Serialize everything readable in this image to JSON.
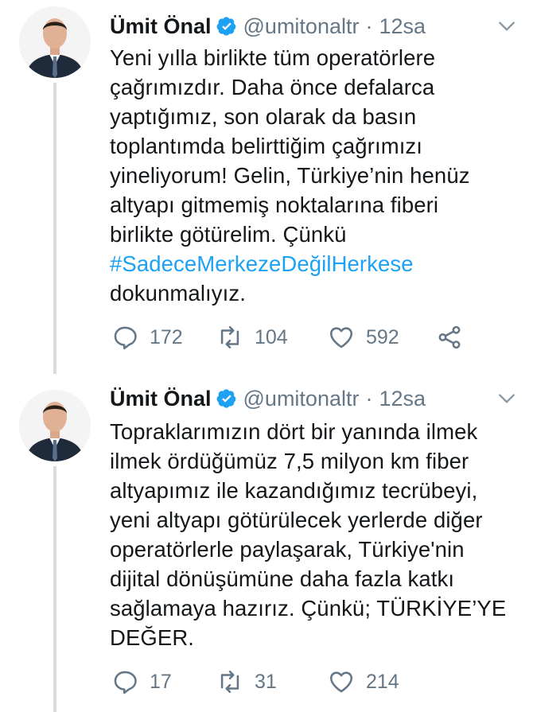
{
  "tweets": [
    {
      "name": "Ümit Önal",
      "handle": "@umitonaltr",
      "separator": "·",
      "time": "12sa",
      "text_before": "Yeni yılla birlikte tüm operatörlere\nçağrımızdır. Daha önce defalarca\nyaptığımız, son olarak da basın\ntoplantımda belirttiğim çağrımızı\nyineliyorum! Gelin, Türkiye’nin henüz\naltyapı gitmemiş noktalarına fiberi\nbirlikte götürelim. Çünkü\n",
      "hashtag": "#SadeceMerkezeDeğilHerkese",
      "text_after": "\ndokunmalıyız.",
      "replies": "172",
      "retweets": "104",
      "likes": "592"
    },
    {
      "name": "Ümit Önal",
      "handle": "@umitonaltr",
      "separator": "·",
      "time": "12sa",
      "text_before": "Topraklarımızın dört bir yanında ilmek\nilmek ördüğümüz 7,5 milyon km fiber\naltyapımız ile kazandığımız tecrübeyi,\nyeni altyapı götürülecek yerlerde diğer\noperatörlerle paylaşarak, Türkiye'nin\ndijital dönüşümüne daha fazla katkı\nsağlamaya hazırız. Çünkü; TÜRKİYE’YE\nDEĞER.",
      "replies": "17",
      "retweets": "31",
      "likes": "214"
    }
  ],
  "icons": {
    "verified": "verified-badge-icon",
    "caret": "chevron-down-icon",
    "reply": "reply-icon",
    "retweet": "retweet-icon",
    "like": "heart-icon",
    "share": "share-icon"
  },
  "colors": {
    "text": "#14171a",
    "muted": "#657786",
    "accent": "#1da1f2",
    "thread_line": "#d6dce0"
  }
}
